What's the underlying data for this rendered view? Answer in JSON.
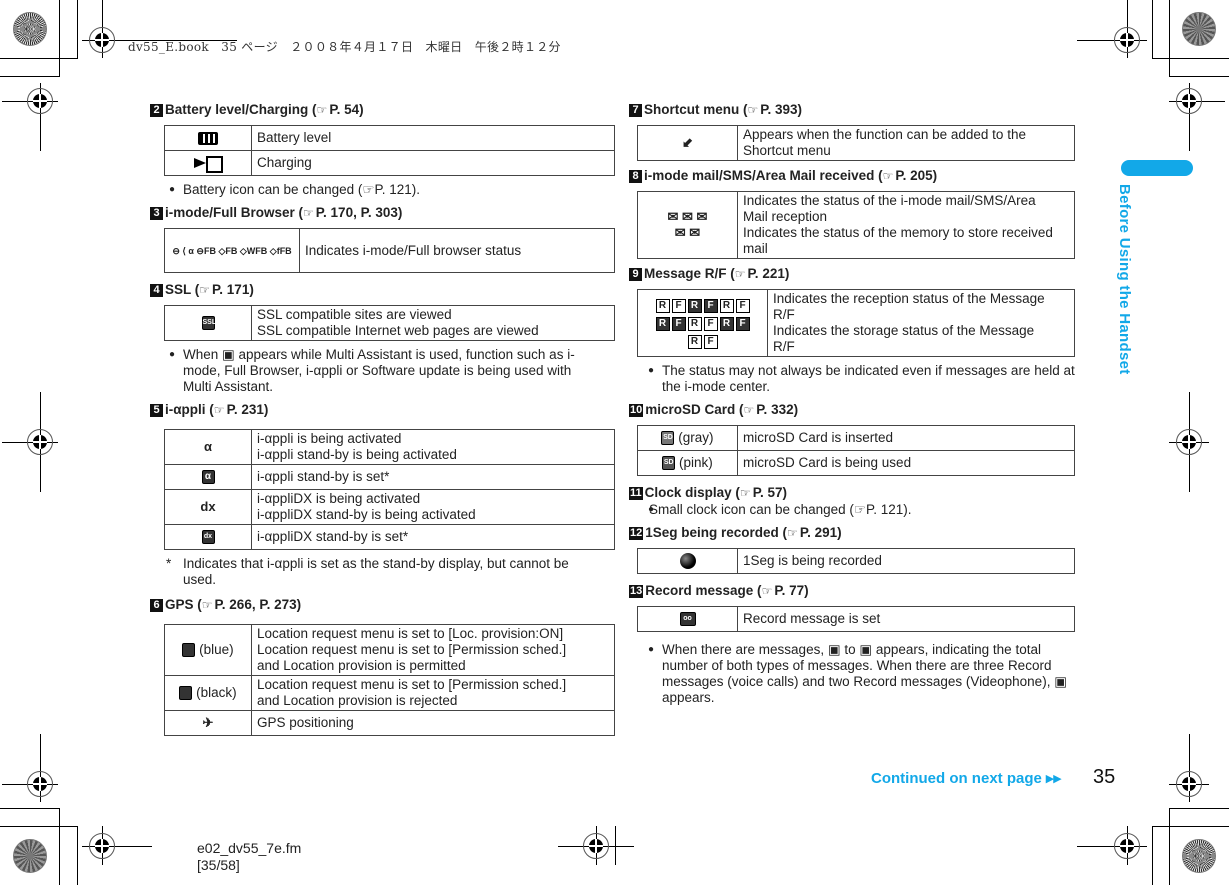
{
  "print_header": "dv55_E.book　35 ページ　２００８年４月１７日　木曜日　午後２時１２分",
  "side_tab": "Before Using the Handset",
  "footer": {
    "continued": "Continued on next page",
    "continued_arrow": "▸▸",
    "page_number": "35",
    "file_name": "e02_dv55_7e.fm",
    "file_pages": "[35/58]"
  },
  "ref_glyph": "☞",
  "sections": {
    "s2": {
      "num": "2",
      "title": "Battery level/Charging (",
      "ref": "P. 54)",
      "rows": [
        {
          "icon": "battery-level-icon",
          "desc": [
            "Battery level"
          ]
        },
        {
          "icon": "charging-icon",
          "desc": [
            "Charging"
          ]
        }
      ],
      "bullet": "Battery icon can be changed (☞P. 121)."
    },
    "s3": {
      "num": "3",
      "title": "i-mode/Full Browser (",
      "ref": "P. 170, P. 303)",
      "icon_glyphs": "⊖ ⟨ α ⊖FB ◇FB ◇WFB ◇fFB",
      "rows": [
        {
          "desc": [
            "Indicates i-mode/Full browser status"
          ]
        }
      ]
    },
    "s4": {
      "num": "4",
      "title": "SSL (",
      "ref": "P. 171)",
      "icon_label": "SSL",
      "rows": [
        {
          "desc": [
            "SSL compatible sites are viewed",
            "SSL compatible Internet web pages are viewed"
          ]
        }
      ],
      "bullet": "When ▣ appears while Multi Assistant is used, function such as i-mode, Full Browser, i-αppli or Software update is being used with Multi Assistant."
    },
    "s5": {
      "num": "5",
      "title": "i-αppli (",
      "ref": "P. 231)",
      "rows": [
        {
          "icon": "α",
          "desc": [
            "i-αppli is being activated",
            "i-αppli stand-by is being activated"
          ]
        },
        {
          "icon": "α",
          "desc": [
            "i-αppli stand-by is set*"
          ]
        },
        {
          "icon": "dx",
          "desc": [
            "i-αppliDX is being activated",
            "i-αppliDX stand-by is being activated"
          ]
        },
        {
          "icon": "dx",
          "desc": [
            "i-αppliDX stand-by is set*"
          ]
        }
      ],
      "note_star": "*",
      "note": "Indicates that i-αppli is set as the stand-by display, but cannot be used."
    },
    "s6": {
      "num": "6",
      "title": "GPS (",
      "ref": "P. 266, P. 273)",
      "rows": [
        {
          "icon_label": "(blue)",
          "desc": [
            "Location request menu is set to [Loc. provision:ON]",
            "Location request menu is set to [Permission sched.]",
            "and Location provision is permitted"
          ]
        },
        {
          "icon_label": "(black)",
          "desc": [
            "Location request menu is set to [Permission sched.]",
            "and Location provision is rejected"
          ]
        },
        {
          "icon_label": "",
          "desc": [
            "GPS positioning"
          ]
        }
      ]
    },
    "s7": {
      "num": "7",
      "title": "Shortcut menu (",
      "ref": "P. 393)",
      "rows": [
        {
          "desc": [
            "Appears when the function can be added to the",
            "Shortcut menu"
          ]
        }
      ]
    },
    "s8": {
      "num": "8",
      "title": "i-mode mail/SMS/Area Mail received (",
      "ref": "P. 205)",
      "rows": [
        {
          "desc": [
            "Indicates the status of the i-mode mail/SMS/Area",
            "Mail reception",
            "Indicates the status of the memory to store received",
            "mail"
          ]
        }
      ]
    },
    "s9": {
      "num": "9",
      "title": "Message R/F (",
      "ref": "P. 221)",
      "icon_letters": [
        "R",
        "F",
        "R",
        "F",
        "R",
        "F",
        "R",
        "F",
        "R",
        "F",
        "R",
        "F",
        "R",
        "F"
      ],
      "rows": [
        {
          "desc": [
            "Indicates the reception status of the Message",
            "R/F",
            "Indicates the storage status of the Message",
            "R/F"
          ]
        }
      ],
      "bullet": "The status may not always be indicated even if messages are held at the i-mode center."
    },
    "s10": {
      "num": "10",
      "title": "microSD Card (",
      "ref": "P. 332)",
      "rows": [
        {
          "icon_label": "(gray)",
          "desc": [
            "microSD Card is inserted"
          ]
        },
        {
          "icon_label": "(pink)",
          "desc": [
            "microSD Card is being used"
          ]
        }
      ]
    },
    "s11": {
      "num": "11",
      "title": "Clock display (",
      "ref": "P. 57)",
      "bullet": "Small clock icon can be changed (☞P. 121)."
    },
    "s12": {
      "num": "12",
      "title": "1Seg being recorded (",
      "ref": "P. 291)",
      "rows": [
        {
          "desc": [
            "1Seg is being recorded"
          ]
        }
      ]
    },
    "s13": {
      "num": "13",
      "title": "Record message (",
      "ref": "P. 77)",
      "rows": [
        {
          "desc": [
            "Record message is set"
          ]
        }
      ],
      "bullet": "When there are messages, ▣ to ▣ appears, indicating the total number of both types of messages. When there are three Record messages (voice calls) and two Record messages (Videophone), ▣ appears."
    }
  },
  "colors": {
    "accent": "#12a8e8",
    "text": "#222222",
    "badge": "#111111"
  }
}
